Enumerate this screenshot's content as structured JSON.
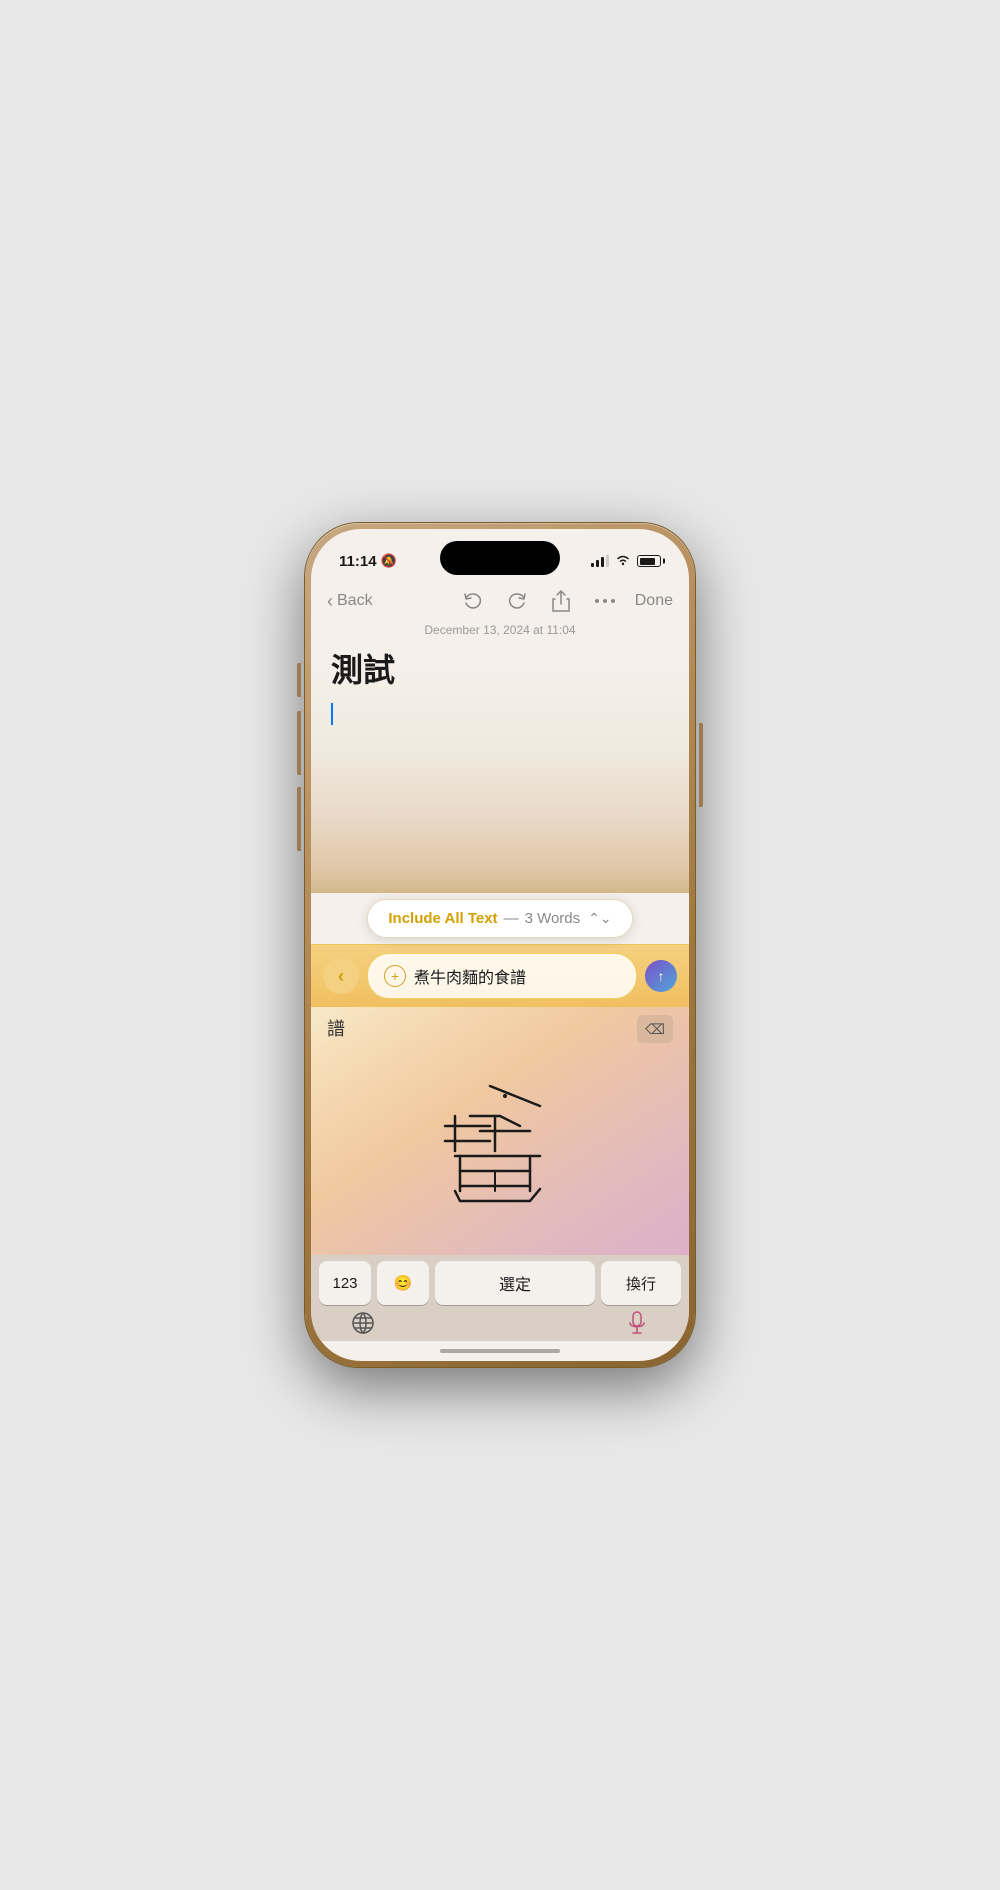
{
  "status_bar": {
    "time": "11:14",
    "bell_slash": "🔕"
  },
  "nav": {
    "back_label": "Back",
    "done_label": "Done"
  },
  "note": {
    "timestamp": "December 13, 2024 at 11:04",
    "title": "測試"
  },
  "include_badge": {
    "text": "Include All Text",
    "separator": "—",
    "count": "3 Words"
  },
  "input": {
    "value": "煮牛肉麵的食譜"
  },
  "handwriting": {
    "suggestion": "譜",
    "drawn_char": "譜"
  },
  "keyboard": {
    "num_label": "123",
    "emoji_label": "😊",
    "confirm_label": "選定",
    "newline_label": "換行"
  }
}
